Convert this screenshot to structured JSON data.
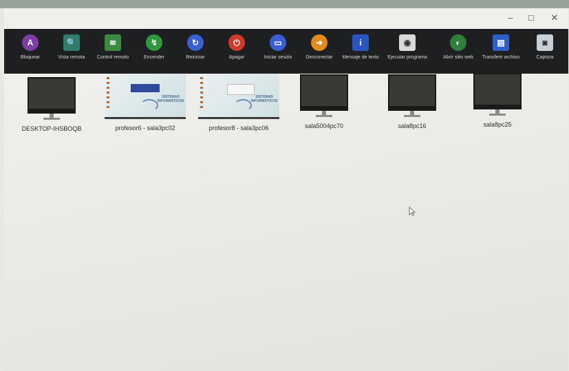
{
  "window": {
    "minimize_glyph": "–",
    "maximize_glyph": "□",
    "close_glyph": "✕"
  },
  "toolbar": {
    "items": [
      {
        "label": "Bloquear",
        "icon": "lock-icon",
        "glyph": "A",
        "color": "#7b3fa3"
      },
      {
        "label": "Vista remota",
        "icon": "remote-view-icon",
        "glyph": "🔍",
        "color": "#2f7d6d"
      },
      {
        "label": "Control remoto",
        "icon": "wifi-icon",
        "glyph": "≋",
        "color": "#3b8a44"
      },
      {
        "label": "Encender",
        "icon": "power-on-icon",
        "glyph": "↯",
        "color": "#2e9a3c"
      },
      {
        "label": "Reiniciar",
        "icon": "restart-icon",
        "glyph": "↻",
        "color": "#3a5fd1"
      },
      {
        "label": "Apagar",
        "icon": "power-off-icon",
        "glyph": "⏻",
        "color": "#d23a2b"
      },
      {
        "label": "Iniciar sesión",
        "icon": "login-icon",
        "glyph": "▭",
        "color": "#3b5fd0"
      },
      {
        "label": "Desconectar",
        "icon": "logout-icon",
        "glyph": "➜",
        "color": "#e38a1e"
      },
      {
        "label": "Mensaje de texto",
        "icon": "message-icon",
        "glyph": "i",
        "color": "#2c55c4"
      },
      {
        "label": "Ejecutar programa",
        "icon": "run-program-icon",
        "glyph": "◉",
        "color": "#d9d9d9"
      },
      {
        "label": "Abrir sitio web",
        "icon": "globe-icon",
        "glyph": "◐",
        "color": "#2e7f3a"
      },
      {
        "label": "Transferir archivo",
        "icon": "file-transfer-icon",
        "glyph": "▤",
        "color": "#2e5fc9"
      },
      {
        "label": "Captura",
        "icon": "capture-icon",
        "glyph": "◙",
        "color": "#c9cfd6"
      }
    ]
  },
  "computers": [
    {
      "name": "DESKTOP-IHSBOQB",
      "type": "offline"
    },
    {
      "name": "profesor6 - sala3pc02",
      "type": "thumb-blue",
      "brand": "SISTEMAS INFORMÁTICOS"
    },
    {
      "name": "profesor8 - sala3pc06",
      "type": "thumb-grey",
      "brand": "SISTEMAS INFORMÁTICOS"
    },
    {
      "name": "sala5004pc70",
      "type": "offline"
    },
    {
      "name": "sala8pc16",
      "type": "offline"
    },
    {
      "name": "sala8pc25",
      "type": "offline"
    }
  ]
}
